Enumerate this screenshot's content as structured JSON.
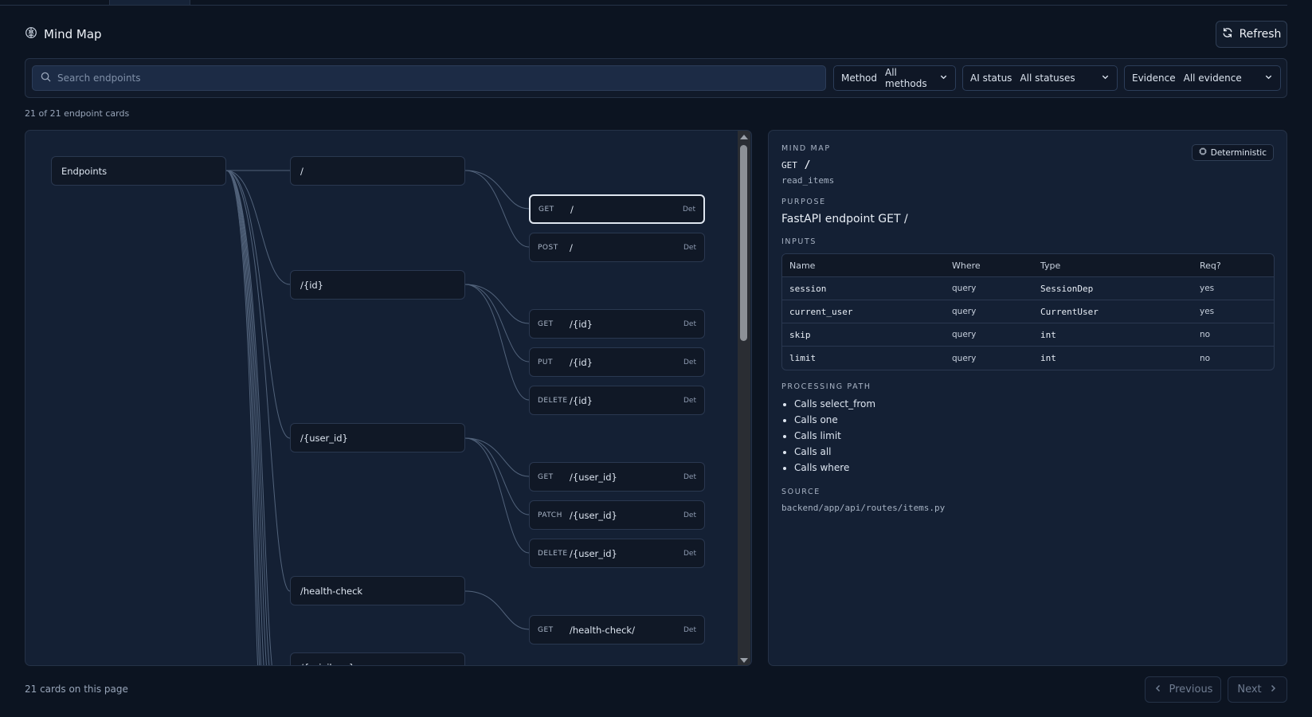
{
  "header": {
    "title": "Mind Map",
    "refresh_label": "Refresh",
    "title_icon": "brain-icon",
    "refresh_icon": "refresh-icon"
  },
  "filters": {
    "search_placeholder": "Search endpoints",
    "method": {
      "label": "Method",
      "value": "All methods"
    },
    "ai_status": {
      "label": "AI status",
      "value": "All statuses"
    },
    "evidence": {
      "label": "Evidence",
      "value": "All evidence"
    }
  },
  "count_text": "21 of 21 endpoint cards",
  "map": {
    "root": "Endpoints",
    "groups": [
      "/",
      "/{id}",
      "/{user_id}",
      "/health-check",
      "/{privilege}..."
    ],
    "leaves": [
      {
        "method": "GET",
        "path": "/",
        "tag": "Det",
        "selected": true
      },
      {
        "method": "POST",
        "path": "/",
        "tag": "Det"
      },
      {
        "method": "GET",
        "path": "/{id}",
        "tag": "Det"
      },
      {
        "method": "PUT",
        "path": "/{id}",
        "tag": "Det"
      },
      {
        "method": "DELETE",
        "path": "/{id}",
        "tag": "Det"
      },
      {
        "method": "GET",
        "path": "/{user_id}",
        "tag": "Det"
      },
      {
        "method": "PATCH",
        "path": "/{user_id}",
        "tag": "Det"
      },
      {
        "method": "DELETE",
        "path": "/{user_id}",
        "tag": "Det"
      },
      {
        "method": "GET",
        "path": "/health-check/",
        "tag": "Det"
      }
    ]
  },
  "detail": {
    "kicker": "MIND MAP",
    "badge": "Deterministic",
    "method": "GET",
    "path": "/",
    "function": "read_items",
    "purpose_label": "PURPOSE",
    "purpose": "FastAPI endpoint GET /",
    "inputs_label": "INPUTS",
    "inputs_headers": [
      "Name",
      "Where",
      "Type",
      "Req?"
    ],
    "inputs_rows": [
      [
        "session",
        "query",
        "SessionDep",
        "yes"
      ],
      [
        "current_user",
        "query",
        "CurrentUser",
        "yes"
      ],
      [
        "skip",
        "query",
        "int",
        "no"
      ],
      [
        "limit",
        "query",
        "int",
        "no"
      ]
    ],
    "processing_label": "PROCESSING PATH",
    "processing": [
      "Calls select_from",
      "Calls one",
      "Calls limit",
      "Calls all",
      "Calls where"
    ],
    "source_label": "SOURCE",
    "source": "backend/app/api/routes/items.py"
  },
  "footer": {
    "count": "21 cards on this page",
    "previous": "Previous",
    "next": "Next"
  }
}
